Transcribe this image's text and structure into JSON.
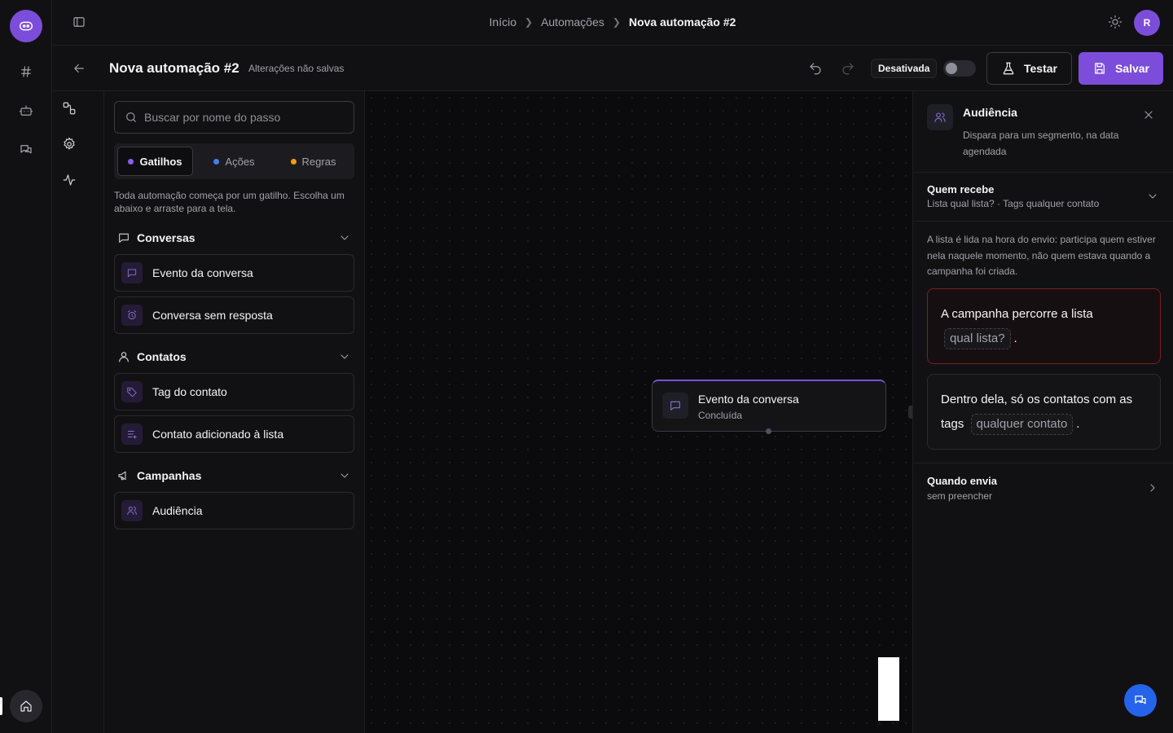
{
  "breadcrumb": [
    "Início",
    "Automações",
    "Nova automação #2"
  ],
  "user_initial": "R",
  "editor": {
    "title": "Nova automação #2",
    "unsaved": "Alterações não salvas",
    "status": "Desativada",
    "test_label": "Testar",
    "save_label": "Salvar"
  },
  "steps": {
    "search_placeholder": "Buscar por nome do passo",
    "tabs": [
      {
        "label": "Gatilhos",
        "dot": "#8b5cf6",
        "active": true
      },
      {
        "label": "Ações",
        "dot": "#3b82f6"
      },
      {
        "label": "Regras",
        "dot": "#f59e0b"
      }
    ],
    "hint": "Toda automação começa por um gatilho. Escolha um abaixo e arraste para a tela.",
    "groups": [
      {
        "label": "Conversas",
        "icon": "chat-icon",
        "items": [
          {
            "label": "Evento da conversa",
            "icon": "chat-icon"
          },
          {
            "label": "Conversa sem resposta",
            "icon": "alarm-icon"
          }
        ]
      },
      {
        "label": "Contatos",
        "icon": "user-icon",
        "items": [
          {
            "label": "Tag do contato",
            "icon": "tag-icon"
          },
          {
            "label": "Contato adicionado à lista",
            "icon": "list-add-icon"
          }
        ]
      },
      {
        "label": "Campanhas",
        "icon": "megaphone-icon",
        "items": [
          {
            "label": "Audiência",
            "icon": "users-icon"
          }
        ]
      }
    ]
  },
  "canvas": {
    "node": {
      "title": "Evento da conversa",
      "subtitle": "Concluída"
    }
  },
  "details": {
    "title": "Audiência",
    "description": "Dispara para um segmento, na data agendada",
    "who": {
      "title": "Quem recebe",
      "summary": "Lista qual lista? · Tags qualquer contato"
    },
    "explain": "A lista é lida na hora do envio: participa quem estiver nela naquele momento, não quem estava quando a campanha foi criada.",
    "list_card": {
      "text": "A campanha percorre a lista",
      "chip": "qual lista?",
      "end": "."
    },
    "tags_card": {
      "text": "Dentro dela, só os contatos com as tags",
      "chip": "qualquer contato",
      "end": "."
    },
    "when": {
      "title": "Quando envia",
      "summary": "sem preencher"
    }
  },
  "colors": {
    "accent": "#7c4ddb",
    "error_border": "#7f1d1d",
    "fab": "#2563eb"
  }
}
